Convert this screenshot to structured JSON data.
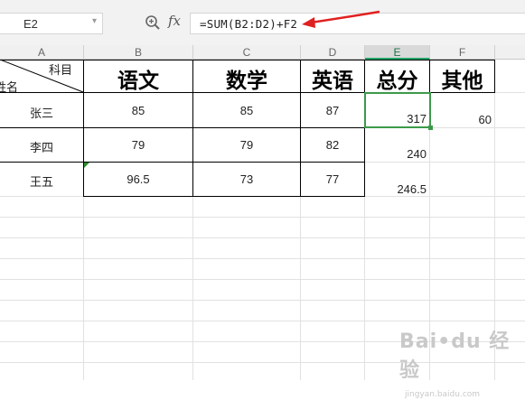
{
  "formula_bar": {
    "name_box": "E2",
    "fx_label": "fx",
    "formula": "=SUM(B2:D2)+F2"
  },
  "columns": [
    "A",
    "B",
    "C",
    "D",
    "E",
    "F"
  ],
  "selected_column": "E",
  "header_row": {
    "diag_top": "科目",
    "diag_bottom": "姓名",
    "subjects": [
      "语文",
      "数学",
      "英语",
      "总分",
      "其他"
    ]
  },
  "rows": [
    {
      "name": "张三",
      "b": "85",
      "c": "85",
      "d": "87",
      "e": "317",
      "f": "60"
    },
    {
      "name": "李四",
      "b": "79",
      "c": "79",
      "d": "82",
      "e": "240",
      "f": ""
    },
    {
      "name": "王五",
      "b": "96.5",
      "c": "73",
      "d": "77",
      "e": "246.5",
      "f": ""
    }
  ],
  "selected_cell": "E2",
  "colors": {
    "selection": "#3c9a4a",
    "arrow": "#e02020"
  }
}
